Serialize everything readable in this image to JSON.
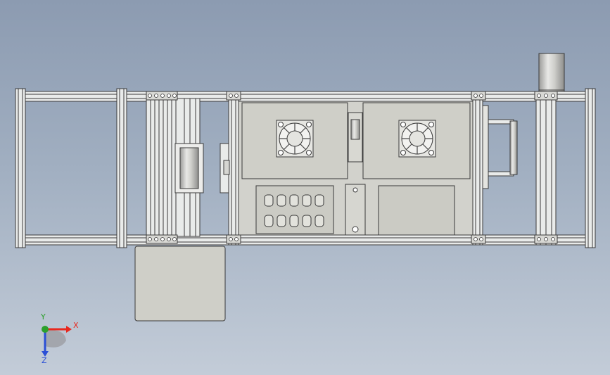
{
  "triad": {
    "x_label": "X",
    "y_label": "Y",
    "z_label": "Z",
    "x_color": "#e8281e",
    "y_color": "#2ca02c",
    "z_color": "#2b4fd6"
  },
  "colors": {
    "frame_fill": "#e9ebea",
    "frame_stroke": "#3a3a3a",
    "panel_fill": "#cfcfc8",
    "cylinder_fill": "#c8c8c4"
  }
}
